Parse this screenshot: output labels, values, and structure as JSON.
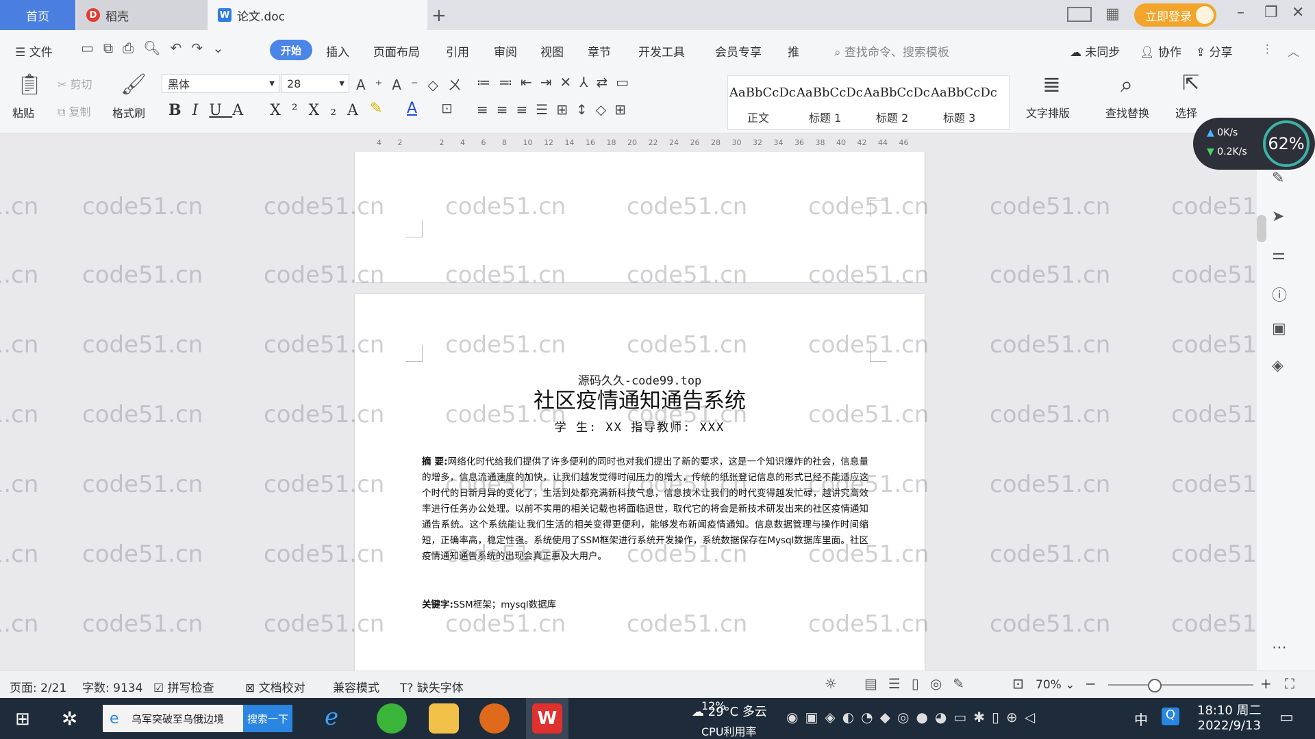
{
  "titlebar": {
    "tab_home": "首页",
    "tab_docer": "稻壳",
    "tab_doc": "论文.doc",
    "login": "立即登录"
  },
  "menu": {
    "file": "文件",
    "items": [
      "开始",
      "插入",
      "页面布局",
      "引用",
      "审阅",
      "视图",
      "章节",
      "开发工具",
      "会员专享",
      "推"
    ],
    "search": "查找命令、搜索模板",
    "sync": "未同步",
    "collab": "协作",
    "share": "分享"
  },
  "ribbon": {
    "paste": "粘贴",
    "cut": "剪切",
    "copy": "复制",
    "format_painter": "格式刷",
    "font_name": "黑体",
    "font_size": "28",
    "style_sample": "AaBbCcDc",
    "styles": [
      "正文",
      "标题 1",
      "标题 2",
      "标题 3"
    ],
    "text_layout": "文字排版",
    "find_replace": "查找替换",
    "select": "选择"
  },
  "ruler_ticks": [
    "4",
    "2",
    "",
    "2",
    "4",
    "6",
    "8",
    "10",
    "12",
    "14",
    "16",
    "18",
    "20",
    "22",
    "24",
    "26",
    "28",
    "30",
    "32",
    "34",
    "36",
    "38",
    "40",
    "42",
    "44",
    "46"
  ],
  "netwidget": {
    "up": "0K/s",
    "down": "0.2K/s",
    "cpu": "62%"
  },
  "document": {
    "watermark_top": "源码久久-code99.top",
    "title": "社区疫情通知通告系统",
    "authors": "学   生: XX  指导教师: XXX",
    "abstract_label": "摘   要:",
    "abstract": "网络化时代给我们提供了许多便利的同时也对我们提出了新的要求，这是一个知识爆炸的社会，信息量的增多，信息流通速度的加快，让我们越发觉得时间压力的增大，传统的纸张登记信息的形式已经不能适应这个时代的日新月异的变化了，生活到处都充满新科技气息，信息技术让我们的时代变得越发忙碌，越讲究高效率进行任务办公处理。以前不实用的相关记载也将面临退世，取代它的将会是新技术研发出来的社区疫情通知通告系统。这个系统能让我们生活的相关变得更便利，能够发布新闻疫情通知。信息数据管理与操作时间缩短，正确率高，稳定性强。系统使用了SSM框架进行系统开发操作，系统数据保存在Mysql数据库里面。社区疫情通知通告系统的出现会真正惠及大用户。",
    "keywords_label": "关键字:",
    "keywords": "SSM框架；mysql数据库",
    "site_watermark": "code51.cn"
  },
  "status": {
    "page": "页面: 2/21",
    "words": "字数: 9134",
    "spell": "拼写检查",
    "proof": "文档校对",
    "compat": "兼容模式",
    "missing_font": "缺失字体",
    "zoom": "70%"
  },
  "taskbar": {
    "search_text": "乌军突破至乌俄边境",
    "search_btn": "搜索一下",
    "weather": "29°C 多云",
    "cpu_pct": "12%",
    "cpu_label": "CPU利用率",
    "ime": "中",
    "time": "18:10 周二",
    "date": "2022/9/13"
  }
}
